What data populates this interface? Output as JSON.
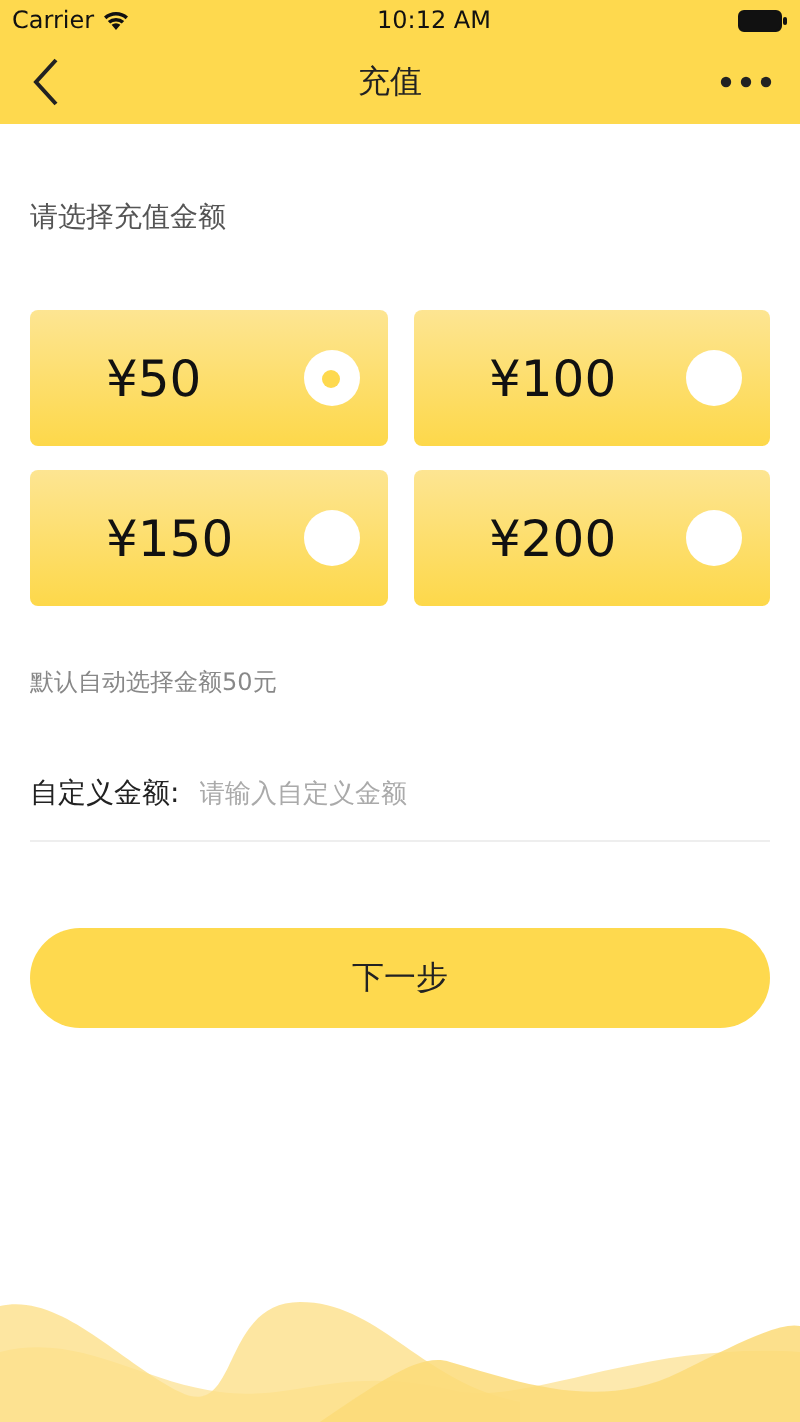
{
  "status_bar": {
    "carrier": "Carrier",
    "time": "10:12 AM"
  },
  "nav": {
    "title": "充值"
  },
  "prompt": "请选择充值金额",
  "amounts": [
    {
      "label": "¥50",
      "selected": true
    },
    {
      "label": "¥100",
      "selected": false
    },
    {
      "label": "¥150",
      "selected": false
    },
    {
      "label": "¥200",
      "selected": false
    }
  ],
  "hint": "默认自动选择金额50元",
  "custom": {
    "label": "自定义金额:",
    "placeholder": "请输入自定义金额"
  },
  "next_button": "下一步"
}
